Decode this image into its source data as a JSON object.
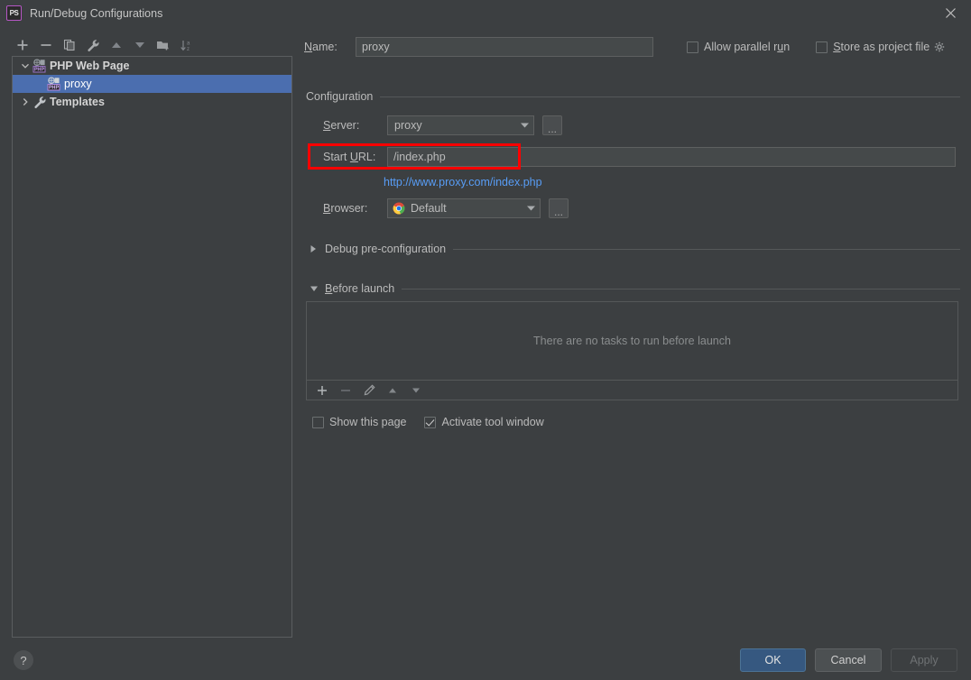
{
  "window": {
    "title": "Run/Debug Configurations",
    "app_icon": "PS",
    "close_icon": "close-icon"
  },
  "toolbar": {
    "items": [
      {
        "name": "add-configuration",
        "icon": "plus-icon"
      },
      {
        "name": "remove-configuration",
        "icon": "minus-icon"
      },
      {
        "name": "copy-configuration",
        "icon": "copy-icon"
      },
      {
        "name": "edit-templates",
        "icon": "wrench-icon"
      },
      {
        "name": "move-up",
        "icon": "arrow-up-icon"
      },
      {
        "name": "move-down",
        "icon": "arrow-down-icon"
      },
      {
        "name": "move-into-folder",
        "icon": "folder-add-icon"
      },
      {
        "name": "sort-configurations",
        "icon": "sort-az-icon"
      }
    ]
  },
  "tree": {
    "nodes": [
      {
        "label": "PHP Web Page",
        "icon": "php-web-page-icon",
        "expanded": true,
        "selected": false,
        "level": 1
      },
      {
        "label": "proxy",
        "icon": "php-web-page-icon",
        "selected": true,
        "level": 2
      },
      {
        "label": "Templates",
        "icon": "wrench-icon",
        "expanded": false,
        "selected": false,
        "level": 1
      }
    ]
  },
  "form": {
    "name_label": "Name:",
    "name_value": "proxy",
    "allow_parallel_run": {
      "label": "Allow parallel run",
      "checked": false,
      "mnemonic": "u"
    },
    "store_as_project_file": {
      "label": "Store as project file",
      "checked": false,
      "gear_icon": "gear-icon"
    },
    "configuration_section": "Configuration",
    "server_label": "Server:",
    "server_value": "proxy",
    "server_browse": "...",
    "start_url_label": "Start URL:",
    "start_url_value": "/index.php",
    "resolved_url": "http://www.proxy.com/index.php",
    "browser_label": "Browser:",
    "browser_value": "Default",
    "browser_icon": "chrome-icon",
    "browser_browse": "...",
    "debug_preconfiguration_section": "Debug pre-configuration",
    "debug_preconfiguration_expanded": false,
    "before_launch_section": "Before launch",
    "before_launch_expanded": true,
    "before_launch_empty_text": "There are no tasks to run before launch",
    "before_launch_toolbar": [
      {
        "name": "add-task",
        "icon": "plus-icon"
      },
      {
        "name": "remove-task",
        "icon": "minus-icon"
      },
      {
        "name": "edit-task",
        "icon": "pencil-icon"
      },
      {
        "name": "task-move-up",
        "icon": "arrow-up-icon"
      },
      {
        "name": "task-move-down",
        "icon": "arrow-down-icon"
      }
    ],
    "show_this_page": {
      "label": "Show this page",
      "checked": false
    },
    "activate_tool_window": {
      "label": "Activate tool window",
      "checked": true
    }
  },
  "footer": {
    "help": "?",
    "ok": "OK",
    "cancel": "Cancel",
    "apply": "Apply"
  },
  "colors": {
    "background": "#3c3f41",
    "selection": "#4b6eaf",
    "link": "#589df6",
    "primary_button": "#365880",
    "highlight_box": "#ff0000"
  }
}
